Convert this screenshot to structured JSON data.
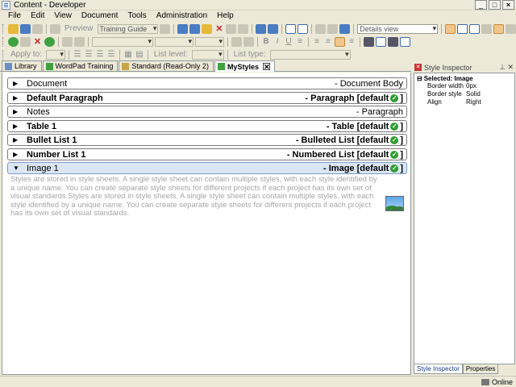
{
  "window": {
    "title": "Content - Developer"
  },
  "menu": [
    "File",
    "Edit",
    "View",
    "Document",
    "Tools",
    "Administration",
    "Help"
  ],
  "toolbar": {
    "preview_label": "Preview",
    "training_guide_value": "Training Guide",
    "view_mode_value": "Details view",
    "apply_to_label": "Apply to:",
    "list_level_label": "List level:",
    "list_type_label": "List type:"
  },
  "doc_tabs": [
    {
      "label": "Library"
    },
    {
      "label": "WordPad Training"
    },
    {
      "label": "Standard (Read-Only 2)"
    },
    {
      "label": "MyStyles"
    }
  ],
  "styles": [
    {
      "name": "Document",
      "type": "- Document Body",
      "bold": false,
      "default": false,
      "expanded": false
    },
    {
      "name": "Default Paragraph",
      "type": "- Paragraph [default",
      "bold": true,
      "default": true,
      "expanded": false
    },
    {
      "name": "Notes",
      "type": "- Paragraph",
      "bold": false,
      "default": false,
      "expanded": false
    },
    {
      "name": "Table 1",
      "type": "- Table [default",
      "bold": true,
      "default": true,
      "expanded": false
    },
    {
      "name": "Bullet List 1",
      "type": "- Bulleted List [default",
      "bold": true,
      "default": true,
      "expanded": false
    },
    {
      "name": "Number List 1",
      "type": "- Numbered List [default",
      "bold": true,
      "default": true,
      "expanded": false
    },
    {
      "name": "Image 1",
      "type": "- Image [default",
      "bold": true,
      "default": true,
      "expanded": true
    }
  ],
  "default_close": "]",
  "expanded_description": "Styles are stored in style sheets. A single style sheet can contain multiple styles, with each style identified by a unique name. You can create separate style sheets for different projects if each project has its own set of visual standards.Styles are stored in style sheets. A single style sheet can contain multiple styles, with each style identified by a unique name. You can create separate style sheets for different projects if each project has its own set of visual standards.",
  "inspector": {
    "header": "Style Inspector",
    "selected_label": "Selected: Image",
    "properties": [
      {
        "key": "Border width",
        "value": "0px"
      },
      {
        "key": "Border style",
        "value": "Solid"
      },
      {
        "key": "Align",
        "value": "Right"
      }
    ],
    "tabs": [
      "Style Inspector",
      "Properties"
    ]
  },
  "status": {
    "text": "Online"
  }
}
